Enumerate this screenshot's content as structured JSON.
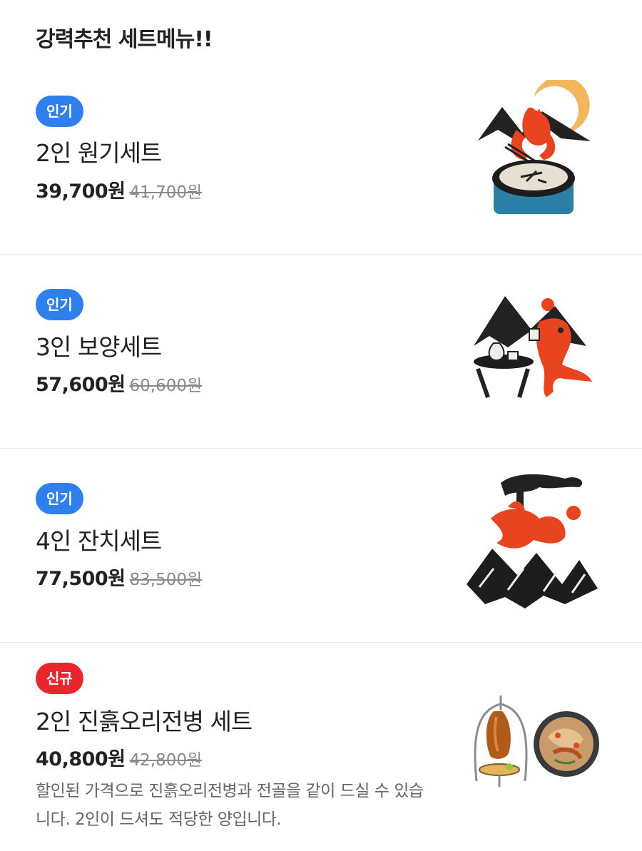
{
  "section": {
    "title": "강력추천 세트메뉴!!"
  },
  "items": [
    {
      "badge": "인기",
      "name": "2인 원기세트",
      "price": "39,700원",
      "original_price": "41,700원",
      "image": "illustration-moon-bowl",
      "badge_color": "#2f80ed"
    },
    {
      "badge": "인기",
      "name": "3인 보양세트",
      "price": "57,600원",
      "original_price": "60,600원",
      "image": "illustration-drinking-table",
      "badge_color": "#2f80ed"
    },
    {
      "badge": "인기",
      "name": "4인 잔치세트",
      "price": "77,500원",
      "original_price": "83,500원",
      "image": "illustration-pine-mountains",
      "badge_color": "#2f80ed"
    },
    {
      "badge": "신규",
      "name": "2인 진흙오리전병 세트",
      "price": "40,800원",
      "original_price": "42,800원",
      "description": "할인된 가격으로 진흙오리전병과 전골을 같이 드실 수 있습니다. 2인이 드셔도 적당한 양입니다.",
      "image": "photo-duck-and-hotpot",
      "badge_color": "#e8262e"
    }
  ]
}
